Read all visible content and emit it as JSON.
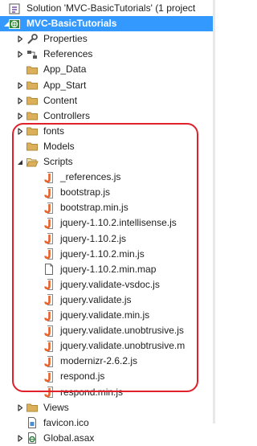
{
  "colors": {
    "selection": "#3399ff",
    "highlight": "#e0202a",
    "folder": "#dcb05a",
    "js_icon": "#e8622a"
  },
  "rows": [
    {
      "label": "Solution 'MVC-BasicTutorials' (1 project",
      "icon": "solution-icon",
      "arrow": "none",
      "depth": 0
    },
    {
      "label": "MVC-BasicTutorials",
      "icon": "web-project-icon",
      "arrow": "expanded",
      "depth": 0,
      "selected": true
    },
    {
      "label": "Properties",
      "icon": "wrench-icon",
      "arrow": "collapsed",
      "depth": 1
    },
    {
      "label": "References",
      "icon": "references-icon",
      "arrow": "collapsed",
      "depth": 1
    },
    {
      "label": "App_Data",
      "icon": "folder-icon",
      "arrow": "none",
      "depth": 1
    },
    {
      "label": "App_Start",
      "icon": "folder-icon",
      "arrow": "collapsed",
      "depth": 1
    },
    {
      "label": "Content",
      "icon": "folder-icon",
      "arrow": "collapsed",
      "depth": 1
    },
    {
      "label": "Controllers",
      "icon": "folder-icon",
      "arrow": "collapsed",
      "depth": 1
    },
    {
      "label": "fonts",
      "icon": "folder-icon",
      "arrow": "collapsed",
      "depth": 1
    },
    {
      "label": "Models",
      "icon": "folder-icon",
      "arrow": "none",
      "depth": 1
    },
    {
      "label": "Scripts",
      "icon": "folder-open-icon",
      "arrow": "expanded",
      "depth": 1
    },
    {
      "label": "_references.js",
      "icon": "js-file-icon",
      "arrow": "none",
      "depth": 2
    },
    {
      "label": "bootstrap.js",
      "icon": "js-file-icon",
      "arrow": "none",
      "depth": 2
    },
    {
      "label": "bootstrap.min.js",
      "icon": "js-file-icon",
      "arrow": "none",
      "depth": 2
    },
    {
      "label": "jquery-1.10.2.intellisense.js",
      "icon": "js-file-icon",
      "arrow": "none",
      "depth": 2
    },
    {
      "label": "jquery-1.10.2.js",
      "icon": "js-file-icon",
      "arrow": "none",
      "depth": 2
    },
    {
      "label": "jquery-1.10.2.min.js",
      "icon": "js-file-icon",
      "arrow": "none",
      "depth": 2
    },
    {
      "label": "jquery-1.10.2.min.map",
      "icon": "map-file-icon",
      "arrow": "none",
      "depth": 2
    },
    {
      "label": "jquery.validate-vsdoc.js",
      "icon": "js-file-icon",
      "arrow": "none",
      "depth": 2
    },
    {
      "label": "jquery.validate.js",
      "icon": "js-file-icon",
      "arrow": "none",
      "depth": 2
    },
    {
      "label": "jquery.validate.min.js",
      "icon": "js-file-icon",
      "arrow": "none",
      "depth": 2
    },
    {
      "label": "jquery.validate.unobtrusive.js",
      "icon": "js-file-icon",
      "arrow": "none",
      "depth": 2
    },
    {
      "label": "jquery.validate.unobtrusive.m",
      "icon": "js-file-icon",
      "arrow": "none",
      "depth": 2
    },
    {
      "label": "modernizr-2.6.2.js",
      "icon": "js-file-icon",
      "arrow": "none",
      "depth": 2
    },
    {
      "label": "respond.js",
      "icon": "js-file-icon",
      "arrow": "none",
      "depth": 2
    },
    {
      "label": "respond.min.js",
      "icon": "js-file-icon",
      "arrow": "none",
      "depth": 2
    },
    {
      "label": "Views",
      "icon": "folder-icon",
      "arrow": "collapsed",
      "depth": 1
    },
    {
      "label": "favicon.ico",
      "icon": "ico-file-icon",
      "arrow": "none",
      "depth": 1
    },
    {
      "label": "Global.asax",
      "icon": "asax-file-icon",
      "arrow": "collapsed",
      "depth": 1
    }
  ]
}
